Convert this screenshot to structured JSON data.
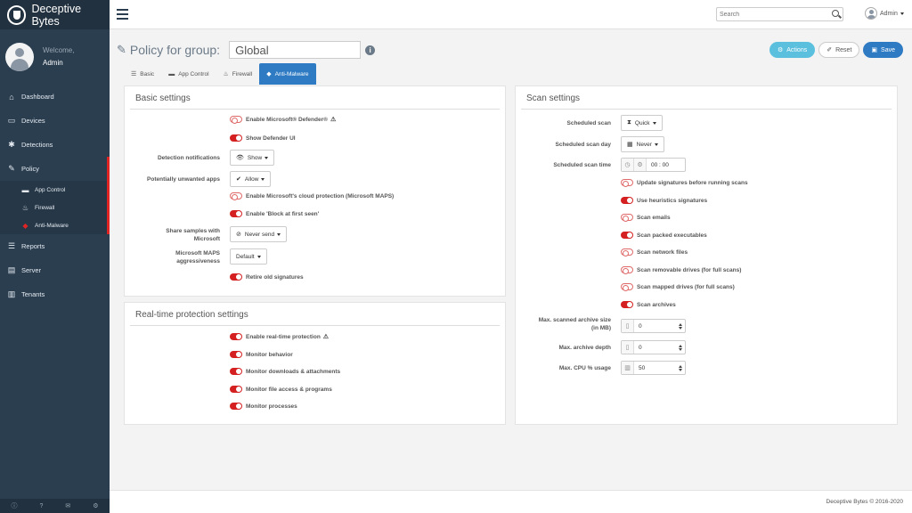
{
  "app": {
    "brand": "Deceptive Bytes"
  },
  "user": {
    "welcome": "Welcome,",
    "name": "Admin"
  },
  "topbar": {
    "search_placeholder": "Search",
    "user_label": "Admin"
  },
  "sidebar": {
    "items": [
      {
        "label": "Dashboard"
      },
      {
        "label": "Devices"
      },
      {
        "label": "Detections"
      },
      {
        "label": "Policy"
      },
      {
        "label": "Reports"
      },
      {
        "label": "Server"
      },
      {
        "label": "Tenants"
      }
    ],
    "policy_sub": [
      {
        "label": "App Control"
      },
      {
        "label": "Firewall"
      },
      {
        "label": "Anti-Malware"
      }
    ]
  },
  "page": {
    "title": "Policy for group:",
    "group": "Global"
  },
  "buttons": {
    "actions": "Actions",
    "reset": "Reset",
    "save": "Save"
  },
  "tabs": [
    {
      "label": "Basic"
    },
    {
      "label": "App Control"
    },
    {
      "label": "Firewall"
    },
    {
      "label": "Anti-Malware"
    }
  ],
  "basic": {
    "title": "Basic settings",
    "enable_defender": "Enable Microsoft® Defender®",
    "show_defender_ui": "Show Defender UI",
    "detection_notifications_label": "Detection notifications",
    "detection_notifications_value": "Show",
    "pua_label": "Potentially unwanted apps",
    "pua_value": "Allow",
    "cloud_protection": "Enable Microsoft's cloud protection (Microsoft MAPS)",
    "block_first_seen": "Enable 'Block at first seen'",
    "share_samples_label_1": "Share samples with",
    "share_samples_label_2": "Microsoft",
    "share_samples_value": "Never send",
    "maps_label_1": "Microsoft MAPS",
    "maps_label_2": "aggressiveness",
    "maps_value": "Default",
    "retire_old": "Retire old signatures"
  },
  "realtime": {
    "title": "Real-time protection settings",
    "items": [
      {
        "label": "Enable real-time protection"
      },
      {
        "label": "Monitor behavior"
      },
      {
        "label": "Monitor downloads & attachments"
      },
      {
        "label": "Monitor file access & programs"
      },
      {
        "label": "Monitor processes"
      }
    ]
  },
  "scan": {
    "title": "Scan settings",
    "scheduled_scan_label": "Scheduled scan",
    "scheduled_scan_value": "Quick",
    "scan_day_label": "Scheduled scan day",
    "scan_day_value": "Never",
    "scan_time_label": "Scheduled scan time",
    "scan_time_value": "00 : 00",
    "toggles": [
      {
        "label": "Update signatures before running scans"
      },
      {
        "label": "Use heuristics signatures"
      },
      {
        "label": "Scan emails"
      },
      {
        "label": "Scan packed executables"
      },
      {
        "label": "Scan network files"
      },
      {
        "label": "Scan removable drives (for full scans)"
      },
      {
        "label": "Scan mapped drives (for full scans)"
      },
      {
        "label": "Scan archives"
      }
    ],
    "archive_size_label_1": "Max. scanned archive size",
    "archive_size_label_2": "(in MB)",
    "archive_size_value": "0",
    "archive_depth_label": "Max. archive depth",
    "archive_depth_value": "0",
    "cpu_label": "Max. CPU % usage",
    "cpu_value": "50"
  },
  "footer": {
    "copyright": "Deceptive Bytes © 2016-2020"
  }
}
